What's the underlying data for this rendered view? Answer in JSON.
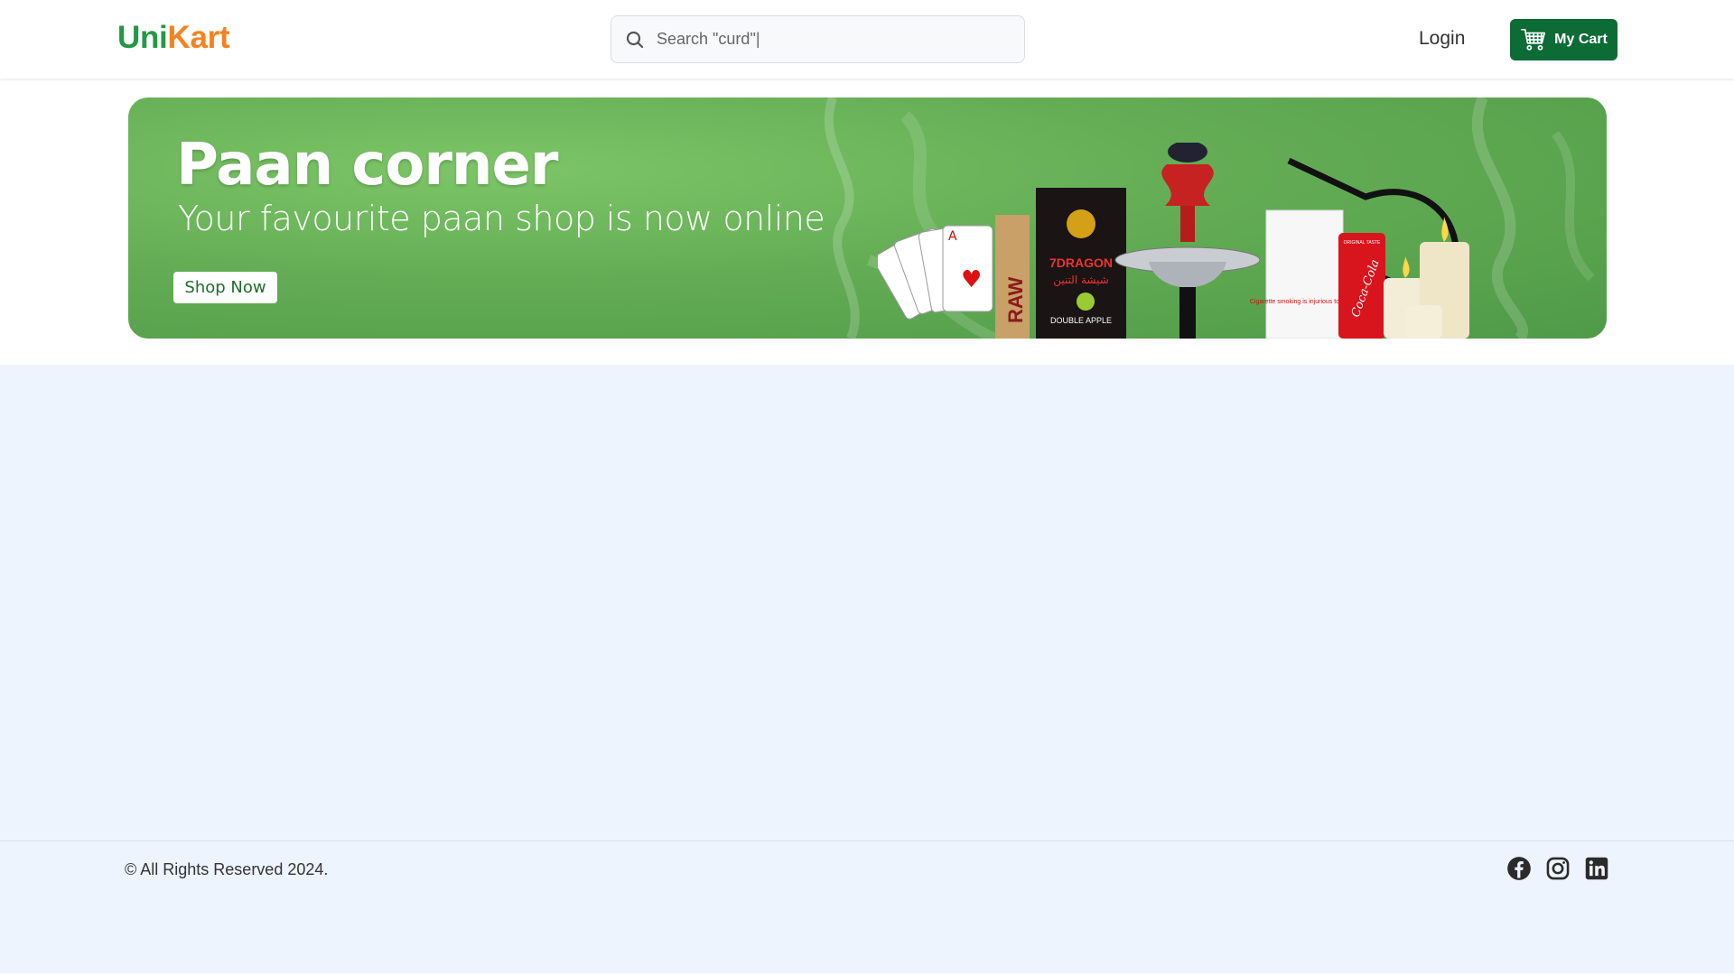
{
  "header": {
    "logo_part1": "Uni",
    "logo_part2": "Kart",
    "search_placeholder": "Search \"curd\"|",
    "login_label": "Login",
    "cart_label": "My Cart"
  },
  "banner": {
    "title": "Paan corner",
    "subtitle": "Your favourite paan shop is now online",
    "cta_label": "Shop Now",
    "product_texts": {
      "rolling_papers": "RAW",
      "tobacco_box": "7DRAGON",
      "tobacco_flavor": "DOUBLE APPLE",
      "tobacco_arabic": "شيشة التنين",
      "cigarette_warning": "Cigarette smoking is injurious to health",
      "soda_brand": "Coca-Cola",
      "soda_top": "ORIGINAL TASTE"
    }
  },
  "footer": {
    "copyright": "© All Rights Reserved 2024.",
    "social_icons": [
      "facebook-icon",
      "instagram-icon",
      "linkedin-icon"
    ]
  },
  "colors": {
    "brand_green": "#229944",
    "brand_orange": "#f58220",
    "cart_button": "#0d6b35",
    "page_background": "#eef4fd",
    "banner_green": "#64ad55"
  }
}
